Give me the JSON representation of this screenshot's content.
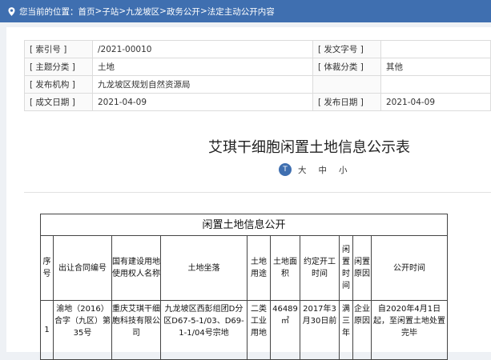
{
  "breadcrumb": {
    "prefix": "您当前的位置：",
    "items": [
      "首页",
      "子站",
      "九龙坡区",
      "政务公开",
      "法定主动公开内容"
    ],
    "sep": " > "
  },
  "meta": [
    {
      "k1": "[ 索引号 ]",
      "v1": "/2021-00010",
      "k2": "[ 发文字号 ]",
      "v2": ""
    },
    {
      "k1": "[ 主题分类 ]",
      "v1": "土地",
      "k2": "[ 体裁分类 ]",
      "v2": "其他"
    },
    {
      "k1": "[ 发布机构 ]",
      "v1": "九龙坡区规划自然资源局",
      "k2": "",
      "v2": ""
    },
    {
      "k1": "[ 成文日期 ]",
      "v1": "2021-04-09",
      "k2": "[ 发布日期 ]",
      "v2": "2021-04-09"
    }
  ],
  "title": "艾琪干细胞闲置土地信息公示表",
  "font_size": {
    "big": "大",
    "mid": "中",
    "small": "小"
  },
  "table": {
    "caption": "闲置土地信息公开",
    "headers": [
      "序号",
      "出让合同编号",
      "国有建设用地使用权人名称",
      "土地坐落",
      "土地用途",
      "土地面积",
      "约定开工时间",
      "闲置时间",
      "闲置原因",
      "公开时间"
    ],
    "row": [
      "1",
      "渝地（2016）合字（九区）第35号",
      "重庆艾琪干细胞科技有限公司",
      "九龙坡区西彭组团D分区D67-5-1/03、D69-1-1/04号宗地",
      "二类工业用地",
      "46489㎡",
      "2017年3月30日前",
      "满三年",
      "企业原因",
      "自2020年4月1日起，至闲置土地处置完毕"
    ]
  },
  "colors": {
    "accent": "#3f6fb0"
  }
}
